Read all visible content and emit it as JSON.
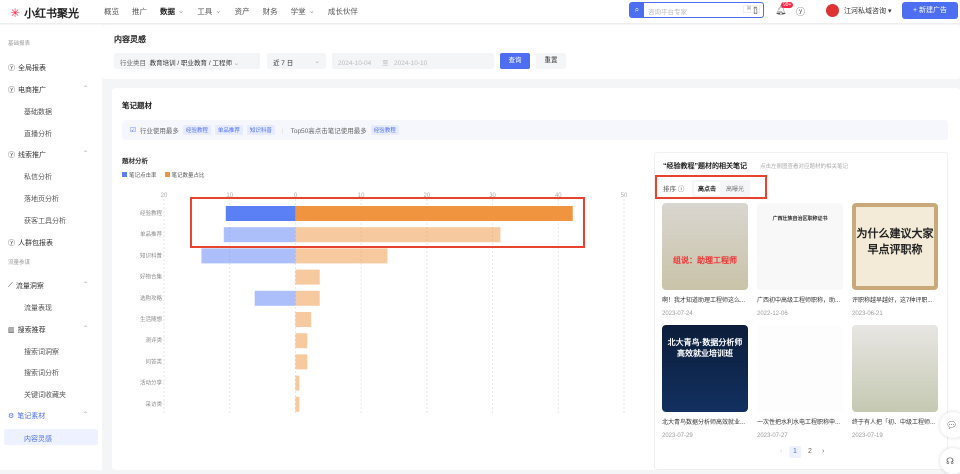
{
  "header": {
    "brand": "小红书聚光",
    "nav": [
      "概览",
      "推广",
      "数据",
      "工具",
      "资产",
      "财务",
      "学堂",
      "成长伙伴"
    ],
    "nav_active": "数据",
    "search_placeholder": "咨询平台专家",
    "search_shortcut": "⌘ K",
    "notification_badge": "99+",
    "account": "江河私域咨询",
    "new_ad": "+ 新建广告"
  },
  "sidebar": {
    "section1": "基础报表",
    "items1": [
      {
        "label": "全局报表",
        "type": "top"
      },
      {
        "label": "电商推广",
        "type": "top"
      },
      {
        "label": "基础数据",
        "type": "sub"
      },
      {
        "label": "直播分析",
        "type": "sub"
      },
      {
        "label": "线索推广",
        "type": "top"
      },
      {
        "label": "私信分析",
        "type": "sub"
      },
      {
        "label": "落地页分析",
        "type": "sub"
      },
      {
        "label": "获客工具分析",
        "type": "sub"
      },
      {
        "label": "人群包报表",
        "type": "top"
      }
    ],
    "section2": "流量参谋",
    "items2": [
      {
        "label": "流量洞察",
        "type": "top"
      },
      {
        "label": "流量表现",
        "type": "sub"
      },
      {
        "label": "搜索推荐",
        "type": "top"
      },
      {
        "label": "搜索词洞察",
        "type": "sub"
      },
      {
        "label": "搜索词分析",
        "type": "sub"
      },
      {
        "label": "关键词收藏夹",
        "type": "sub"
      },
      {
        "label": "笔记素材",
        "type": "top"
      },
      {
        "label": "内容灵感",
        "type": "sub"
      }
    ]
  },
  "filters": {
    "page_title": "内容灵感",
    "industry_label": "行业类目",
    "industry_value": "教育培训 / 职业教育 / 工程师",
    "period": "近 7 日",
    "date_from": "2024-10-04",
    "date_sep": "至",
    "date_to": "2024-10-10",
    "query": "查询",
    "reset": "重置"
  },
  "section": {
    "title": "笔记题材",
    "industry_most": "行业使用最多",
    "industry_tags": [
      "经验教程",
      "单品推荐",
      "知识科普"
    ],
    "top50": "Top50高点击笔记使用最多",
    "top50_tags": [
      "经验教程"
    ],
    "analysis_title": "题材分析"
  },
  "chart_data": {
    "type": "bar",
    "title": "题材分析",
    "orientation": "horizontal-butterfly",
    "categories": [
      "经验教程",
      "单品推荐",
      "知识科普",
      "好物合集",
      "选购攻略",
      "生活随想",
      "测评类",
      "问答类",
      "活动分享",
      "采访类"
    ],
    "series": [
      {
        "name": "笔记点击率",
        "color": "#5b7ff5",
        "direction": "left",
        "values": [
          10.6,
          10.9,
          14.3,
          0,
          6.2,
          0,
          0,
          0,
          0,
          0
        ]
      },
      {
        "name": "笔记数量占比",
        "color": "#f0943f",
        "direction": "right",
        "values": [
          42.2,
          31.2,
          14,
          3.7,
          3.7,
          2.4,
          1.8,
          1.8,
          0.6,
          0.6
        ]
      }
    ],
    "xticks": [
      "20",
      "10",
      "0",
      "10",
      "20",
      "30",
      "40",
      "50"
    ],
    "xlim": [
      -20,
      50
    ],
    "highlighted": [
      "经验教程"
    ],
    "grid": true,
    "legend": "top-left"
  },
  "notes": {
    "title": "“经验教程”题材的相关笔记",
    "hint": "点击左侧图查看对应题材的相关笔记",
    "sort_label": "排序",
    "sort_options": [
      "高点击",
      "高曝光"
    ],
    "sort_active": "高点击",
    "items": [
      {
        "title": "啊！我才知道助理工程师这么...",
        "date": "2023-07-24",
        "cover": "组说：助理工程师"
      },
      {
        "title": "广西初中高级工程师职称，助...",
        "date": "2022-12-06",
        "cover": "广西壮族自治区职称证书"
      },
      {
        "title": "评职称越早越好，这7种评职...",
        "date": "2023-06-21",
        "cover": "为什么建议大家早点评职称"
      },
      {
        "title": "北大青鸟数据分析师高效就业...",
        "date": "2023-07-29",
        "cover": "北大青鸟·数据分析师 高效就业培训班"
      },
      {
        "title": "一次性把水利水电工程职称申...",
        "date": "2023-07-27",
        "cover": ""
      },
      {
        "title": "终于有人把「初、中级工程师...",
        "date": "2023-07-19",
        "cover": ""
      }
    ],
    "pages": [
      "1",
      "2"
    ],
    "current_page": "1"
  }
}
